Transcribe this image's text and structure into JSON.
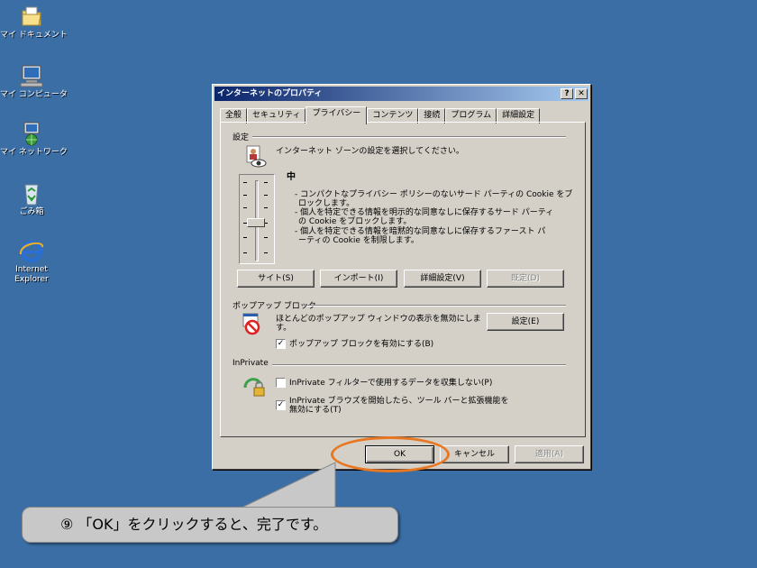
{
  "desktop": {
    "icons": [
      {
        "label": "マイ ドキュメント",
        "icon": "folder-documents-icon"
      },
      {
        "label": "マイ コンピュータ",
        "icon": "computer-icon"
      },
      {
        "label": "マイ ネットワーク",
        "icon": "network-icon"
      },
      {
        "label": "ごみ箱",
        "icon": "recycle-bin-icon"
      },
      {
        "label": "Internet",
        "label2": "Explorer",
        "icon": "internet-explorer-icon"
      }
    ]
  },
  "dialog": {
    "title": "インターネットのプロパティ",
    "help_button": "?",
    "close_button": "✕",
    "tabs": [
      {
        "label": "全般"
      },
      {
        "label": "セキュリティ"
      },
      {
        "label": "プライバシー",
        "active": true
      },
      {
        "label": "コンテンツ"
      },
      {
        "label": "接続"
      },
      {
        "label": "プログラム"
      },
      {
        "label": "詳細設定"
      }
    ],
    "settings": {
      "group_label": "設定",
      "instruction": "インターネット ゾーンの設定を選択してください。",
      "level": "中",
      "description_lines": [
        "- コンパクトなプライバシー ポリシーのないサード パーティの Cookie をブ",
        "ロックします。",
        "- 個人を特定できる情報を明示的な同意なしに保存するサード パーティ",
        "の Cookie をブロックします。",
        "- 個人を特定できる情報を暗黙的な同意なしに保存するファースト パ",
        "ーティの Cookie を制限します。"
      ],
      "buttons": {
        "sites": "サイト(S)",
        "import": "インポート(I)",
        "advanced": "詳細設定(V)",
        "default": "既定(D)"
      }
    },
    "popup": {
      "group_label": "ポップアップ ブロック",
      "description_lines": [
        "ほとんどのポップアップ ウィンドウの表示を無効にしま",
        "す。"
      ],
      "settings_button": "設定(E)",
      "enable_checkbox": "ポップアップ ブロックを有効にする(B)",
      "enable_checked": "✓"
    },
    "inprivate": {
      "group_label": "InPrivate",
      "filter_checkbox": "InPrivate フィルターで使用するデータを収集しない(P)",
      "filter_checked": "",
      "disable_toolbars_lines": [
        "InPrivate ブラウズを開始したら、ツール バーと拡張機能を",
        "無効にする(T)"
      ],
      "disable_toolbars_checked": "✓"
    },
    "footer": {
      "ok": "OK",
      "cancel": "キャンセル",
      "apply": "適用(A)"
    }
  },
  "callout": {
    "text": "⑨ 「OK」をクリックすると、完了です。"
  },
  "colors": {
    "desktop": "#3a6ea5",
    "dialog_face": "#d4d0c8",
    "title_start": "#0a246a",
    "highlight": "#e87722"
  }
}
